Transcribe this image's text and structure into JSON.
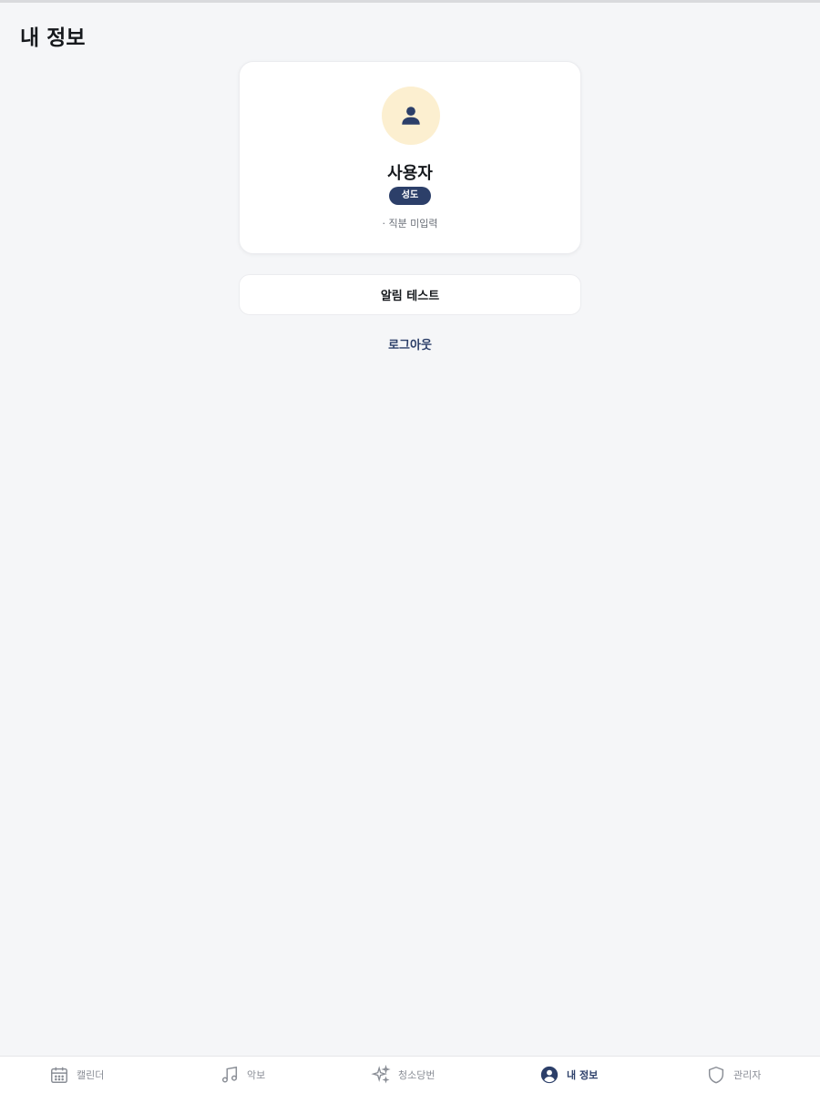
{
  "header": {
    "title": "내 정보"
  },
  "profile": {
    "name": "사용자",
    "role_badge": "성도",
    "position_text": "· 직분 미입력",
    "avatar_icon": "user-icon"
  },
  "actions": {
    "alarm_test_label": "알림 테스트",
    "logout_label": "로그아웃"
  },
  "bottom_nav": {
    "active": "내 정보",
    "items": [
      {
        "label": "캘린더",
        "icon": "calendar-icon"
      },
      {
        "label": "악보",
        "icon": "music-note-icon"
      },
      {
        "label": "청소당번",
        "icon": "sparkles-icon"
      },
      {
        "label": "내 정보",
        "icon": "user-circle-icon"
      },
      {
        "label": "관리자",
        "icon": "shield-icon"
      }
    ]
  },
  "colors": {
    "accent": "#2c3f69",
    "avatar_bg": "#fcefd0",
    "page_bg": "#f5f6f8"
  }
}
